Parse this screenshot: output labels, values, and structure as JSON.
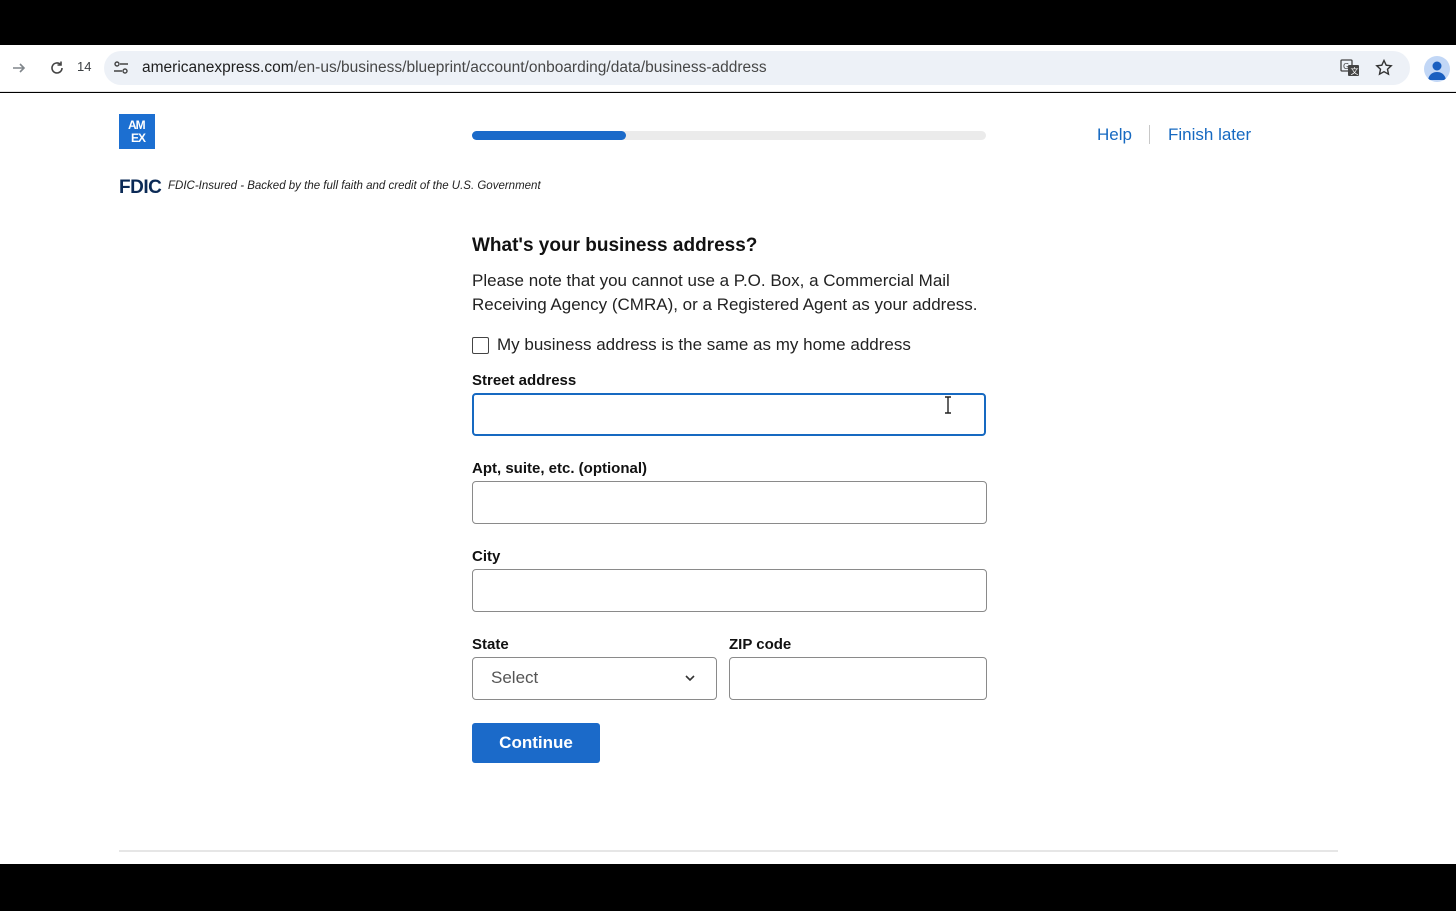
{
  "browser": {
    "tab_count": "14",
    "url_domain": "americanexpress.com",
    "url_path": "/en-us/business/blueprint/account/onboarding/data/business-address",
    "icons": [
      "forward-icon",
      "reload-icon",
      "site-settings-icon",
      "translate-icon",
      "bookmark-star-icon",
      "profile-avatar-icon"
    ]
  },
  "header": {
    "logo_line1": "AM",
    "logo_line2": "EX",
    "progress_fraction": 0.3,
    "help_label": "Help",
    "finish_later_label": "Finish later",
    "brand_color": "#1b6ac9"
  },
  "fdic": {
    "mark": "FDIC",
    "text": "FDIC-Insured - Backed by the full faith and credit of the U.S. Government"
  },
  "form": {
    "heading": "What's your business address?",
    "note": "Please note that you cannot use a P.O. Box, a Commercial Mail Receiving Agency (CMRA), or a Registered Agent as your address.",
    "same_as_home_label": "My business address is the same as my home address",
    "same_as_home_checked": false,
    "street_label": "Street address",
    "street_value": "",
    "apt_label": "Apt, suite, etc. (optional)",
    "apt_value": "",
    "city_label": "City",
    "city_value": "",
    "state_label": "State",
    "state_value": "Select",
    "zip_label": "ZIP code",
    "zip_value": "",
    "continue_label": "Continue"
  }
}
